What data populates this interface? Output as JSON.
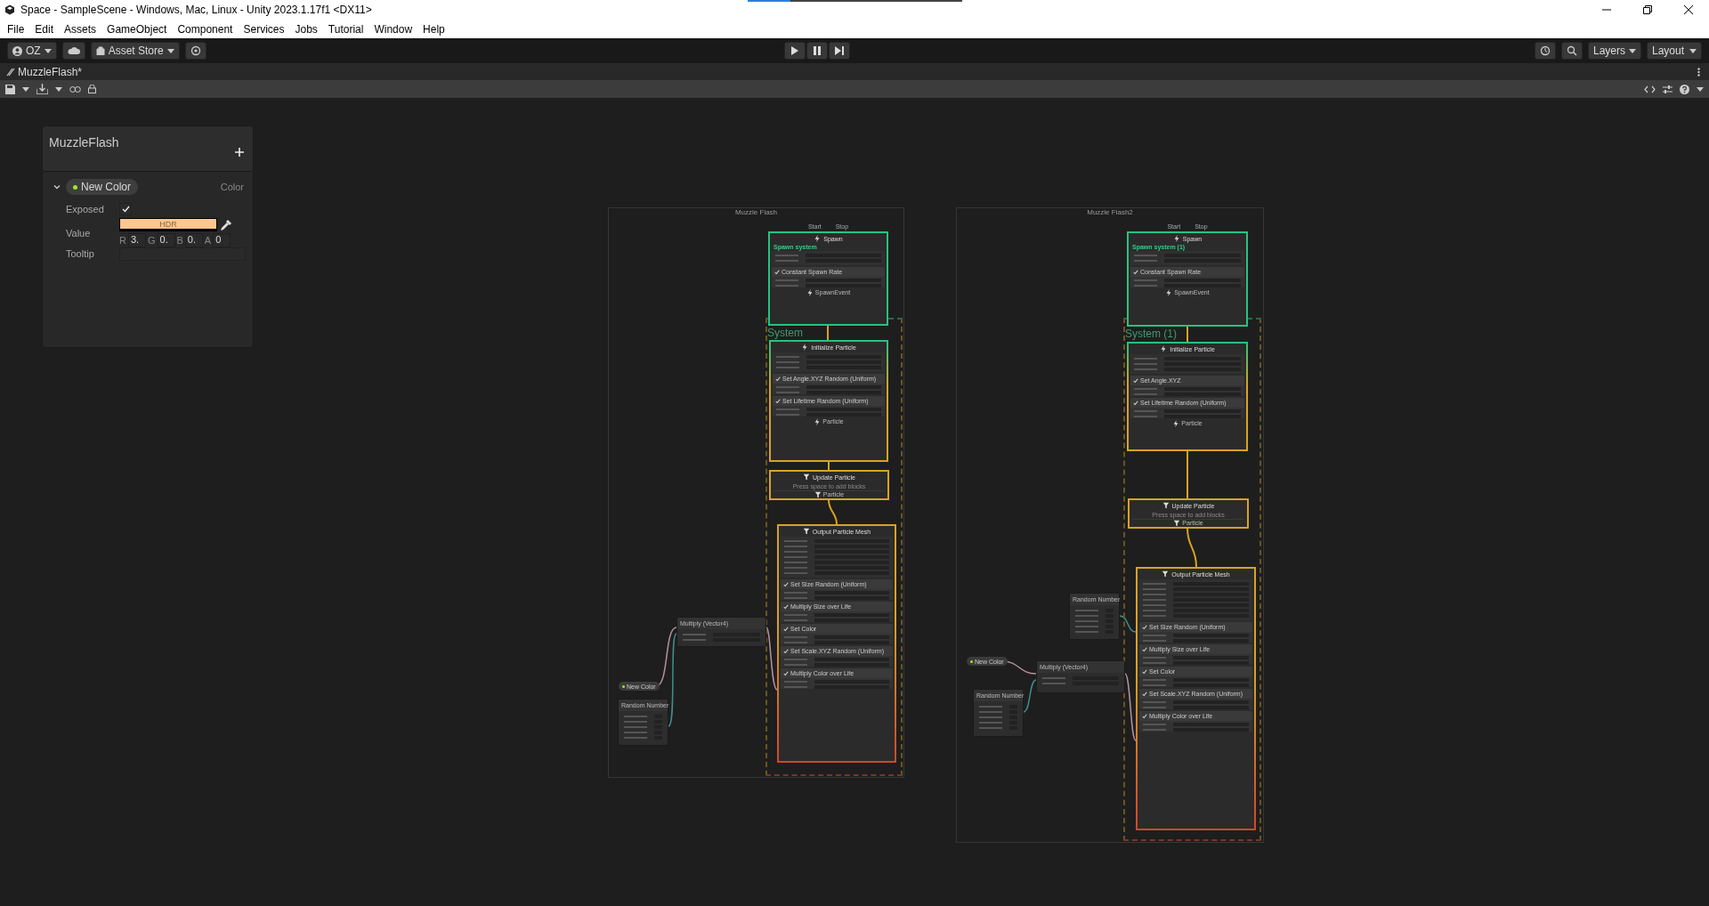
{
  "window": {
    "title": "Space - SampleScene - Windows, Mac, Linux - Unity 2023.1.17f1 <DX11>"
  },
  "menu": [
    "File",
    "Edit",
    "Assets",
    "GameObject",
    "Component",
    "Services",
    "Jobs",
    "Tutorial",
    "Window",
    "Help"
  ],
  "toolbar": {
    "account": "OZ",
    "asset_store": "Asset Store",
    "layers": "Layers",
    "layout": "Layout"
  },
  "tab": {
    "title": "MuzzleFlash*"
  },
  "blackboard": {
    "title": "MuzzleFlash",
    "property": {
      "name": "New Color",
      "type": "Color",
      "expanded": true,
      "exposed_label": "Exposed",
      "exposed": true,
      "value_label": "Value",
      "color": "#ffc690",
      "hdr_label": "HDR",
      "channels": [
        {
          "label": "R",
          "value": "3."
        },
        {
          "label": "G",
          "value": "0."
        },
        {
          "label": "B",
          "value": "0."
        },
        {
          "label": "A",
          "value": "0"
        }
      ],
      "tooltip_label": "Tooltip"
    }
  },
  "graphs": [
    {
      "title": "Muzzle Flash",
      "system_label": "System",
      "contexts": [
        {
          "kind": "spawn",
          "title": "Spawn",
          "inputs": [
            "Start",
            "Stop"
          ],
          "subtitle": "Spawn system",
          "blocks": [
            {
              "title": "Constant Spawn Rate"
            }
          ],
          "footer": "SpawnEvent"
        },
        {
          "kind": "initialize",
          "title": "Initialize Particle",
          "blocks": [
            {
              "title": "Set Angle.XYZ Random (Uniform)"
            },
            {
              "title": "Set Lifetime Random (Uniform)"
            }
          ],
          "footer": "Particle"
        },
        {
          "kind": "update",
          "title": "Update Particle",
          "placeholder": "Press space to add blocks",
          "footer": "Particle"
        },
        {
          "kind": "output",
          "title": "Output Particle Mesh",
          "blocks": [
            {
              "title": "Set Size Random (Uniform)"
            },
            {
              "title": "Multiply Size over Life"
            },
            {
              "title": "Set Color"
            },
            {
              "title": "Set Scale.XYZ Random (Uniform)"
            },
            {
              "title": "Multiply Color over Life"
            }
          ]
        }
      ],
      "operators": [
        {
          "kind": "multiply",
          "title": "Multiply (Vector4)"
        },
        {
          "kind": "property",
          "title": "New Color"
        },
        {
          "kind": "random",
          "title": "Random Number"
        }
      ]
    },
    {
      "title": "Muzzle Flash2",
      "system_label": "System (1)",
      "contexts": [
        {
          "kind": "spawn",
          "title": "Spawn",
          "inputs": [
            "Start",
            "Stop"
          ],
          "subtitle": "Spawn system (1)",
          "blocks": [
            {
              "title": "Constant Spawn Rate"
            }
          ],
          "footer": "SpawnEvent"
        },
        {
          "kind": "initialize",
          "title": "Initialize Particle",
          "blocks": [
            {
              "title": "Set Angle.XYZ"
            },
            {
              "title": "Set Lifetime Random (Uniform)"
            }
          ],
          "footer": "Particle"
        },
        {
          "kind": "update",
          "title": "Update Particle",
          "placeholder": "Press space to add blocks",
          "footer": "Particle"
        },
        {
          "kind": "output",
          "title": "Output Particle Mesh",
          "blocks": [
            {
              "title": "Set Size Random (Uniform)"
            },
            {
              "title": "Multiply Size over Life"
            },
            {
              "title": "Set Color"
            },
            {
              "title": "Set Scale.XYZ Random (Uniform)"
            },
            {
              "title": "Multiply Color over Life"
            }
          ]
        }
      ],
      "operators": [
        {
          "kind": "random",
          "title": "Random Number"
        },
        {
          "kind": "multiply",
          "title": "Multiply (Vector4)"
        },
        {
          "kind": "property",
          "title": "New Color"
        },
        {
          "kind": "random",
          "title": "Random Number"
        }
      ]
    }
  ]
}
